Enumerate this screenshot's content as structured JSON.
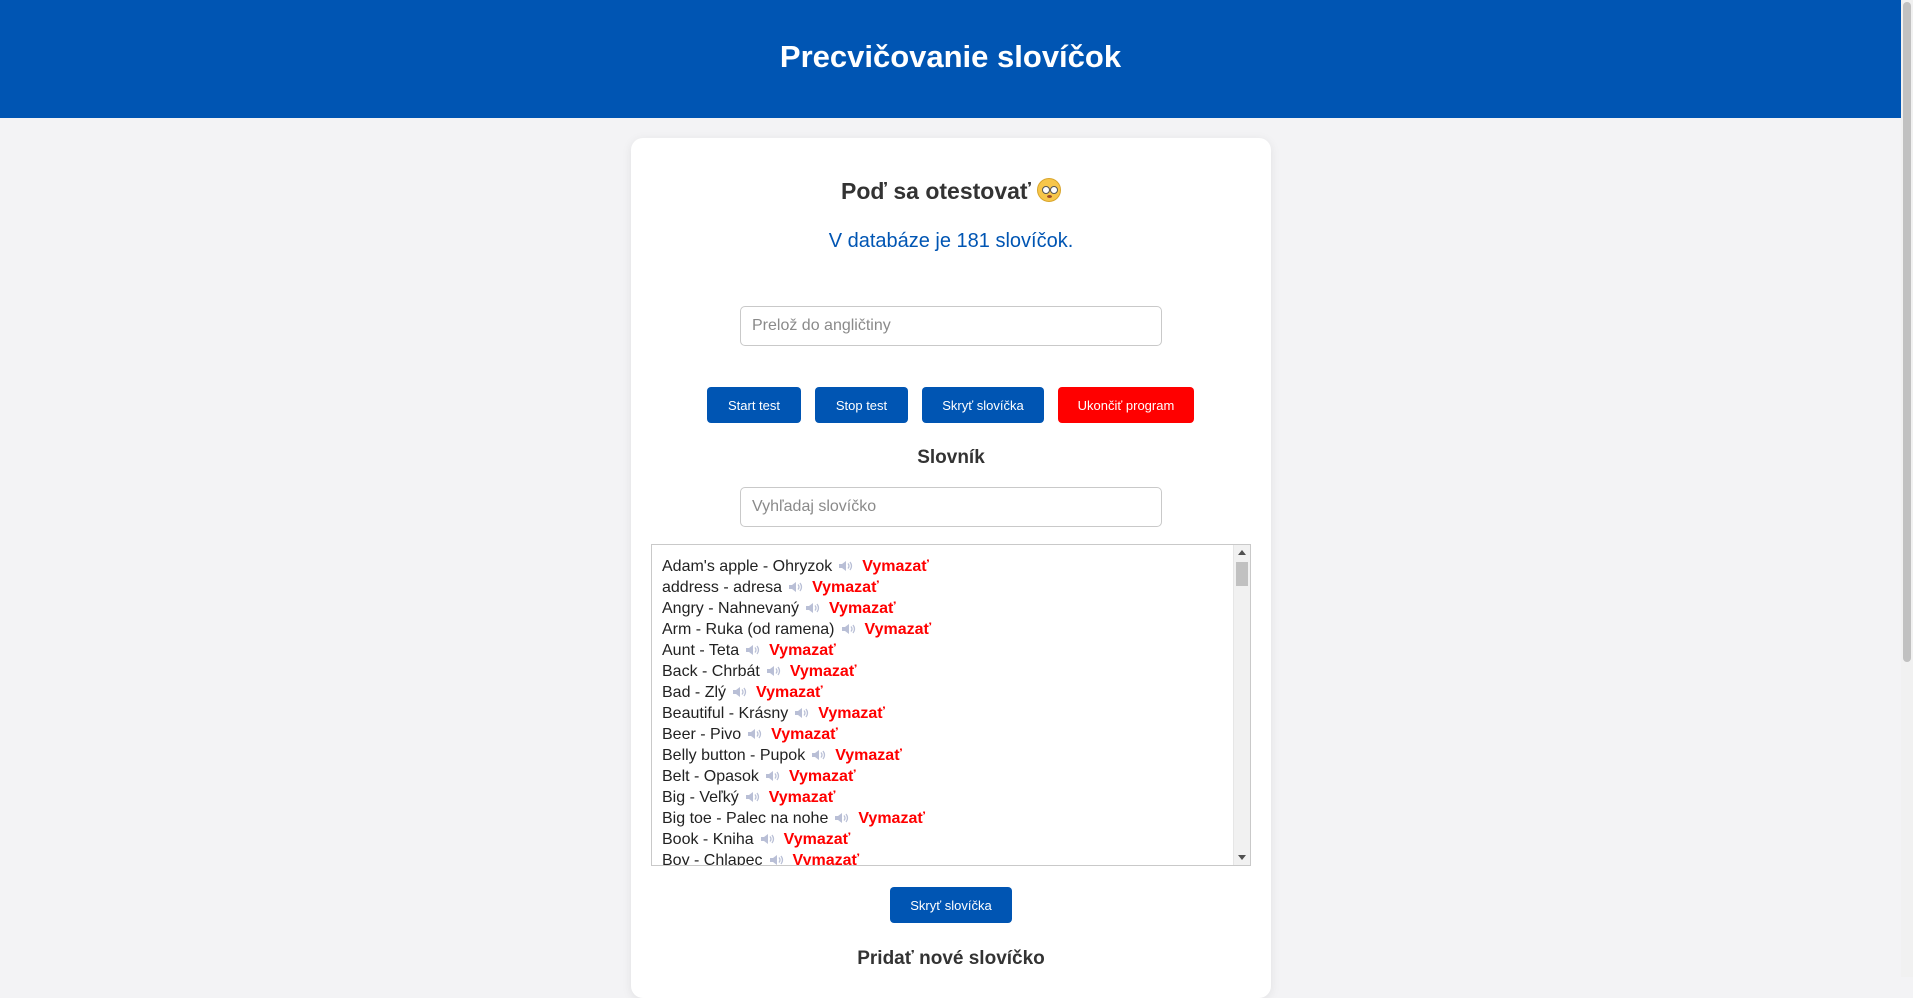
{
  "header": {
    "title": "Precvičovanie slovíčok"
  },
  "card": {
    "title": "Poď sa otestovať",
    "emoji_icon": "smiley-face-icon",
    "count_text": "V databáze je 181 slovíčok."
  },
  "translate_input": {
    "placeholder": "Prelož do angličtiny",
    "value": ""
  },
  "buttons": {
    "start": "Start test",
    "stop": "Stop test",
    "hide": "Skryť slovíčka",
    "quit": "Ukončiť program"
  },
  "dictionary": {
    "title": "Slovník",
    "search_placeholder": "Vyhľadaj slovíčko",
    "delete_label": "Vymazať",
    "speaker_icon": "speaker-icon",
    "words": [
      "Adam's apple - Ohryzok",
      "address - adresa",
      "Angry - Nahnevaný",
      "Arm - Ruka (od ramena)",
      "Aunt - Teta",
      "Back - Chrbát",
      "Bad - Zlý",
      "Beautiful - Krásny",
      "Beer - Pivo",
      "Belly button - Pupok",
      "Belt - Opasok",
      "Big - Veľký",
      "Big toe - Palec na nohe",
      "Book - Kniha",
      "Boy - Chlapec"
    ],
    "hide_button": "Skryť slovíčka"
  },
  "add_word": {
    "title": "Pridať nové slovíčko"
  },
  "colors": {
    "primary": "#0055b3",
    "danger": "#ff0000",
    "background": "#f3f3f5"
  }
}
